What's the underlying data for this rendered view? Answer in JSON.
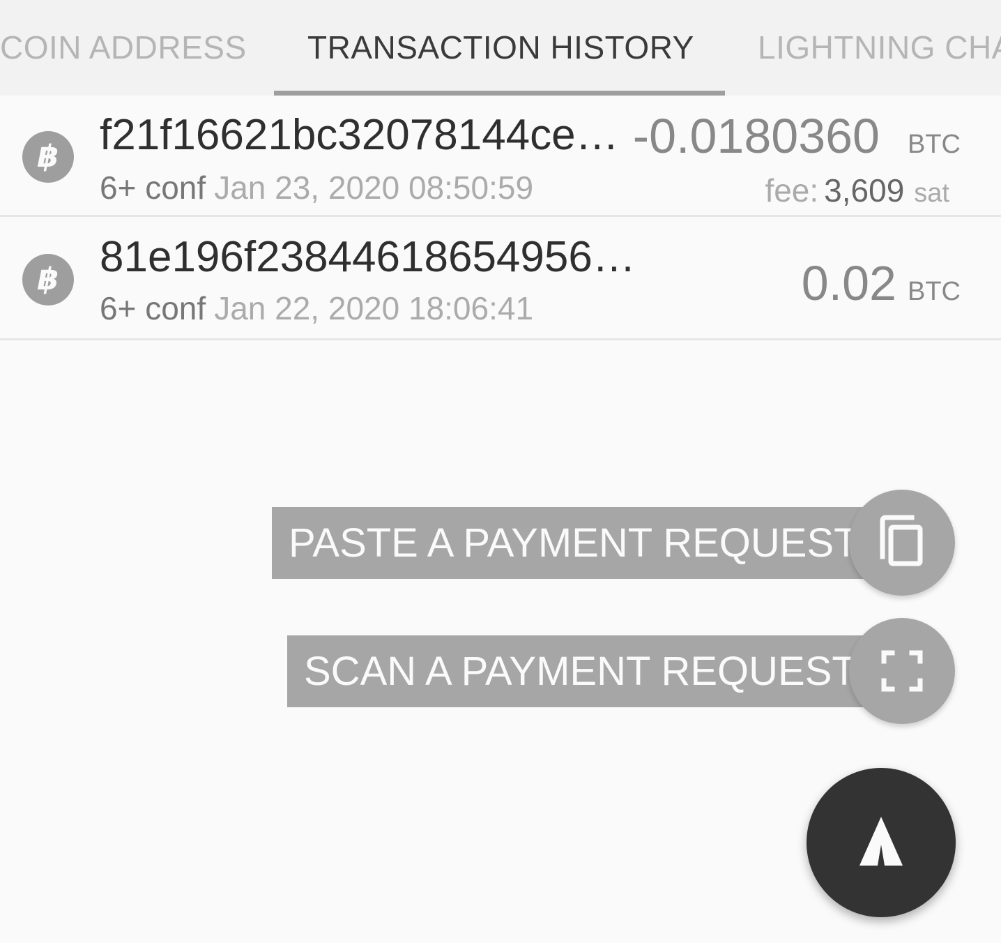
{
  "tabs": [
    {
      "label": "COIN ADDRESS",
      "active": false
    },
    {
      "label": "TRANSACTION HISTORY",
      "active": true
    },
    {
      "label": "LIGHTNING CHA",
      "active": false
    }
  ],
  "transactions": [
    {
      "icon": "bitcoin-icon",
      "hash": "f21f16621bc32078144ce…",
      "confirmations": "6+ conf",
      "date": "Jan 23, 2020 08:50:59",
      "amount": "-0.0180360",
      "unit": "BTC",
      "fee_label": "fee:",
      "fee_value": "3,609",
      "fee_unit": "sat"
    },
    {
      "icon": "bitcoin-icon",
      "hash": "81e196f23844618654956…",
      "confirmations": "6+ conf",
      "date": "Jan 22, 2020 18:06:41",
      "amount": "0.02",
      "unit": "BTC"
    }
  ],
  "speed_dial": {
    "paste": {
      "label": "PASTE A PAYMENT REQUEST",
      "icon": "copy-icon"
    },
    "scan": {
      "label": "SCAN A PAYMENT REQUEST",
      "icon": "scan-frame-icon"
    },
    "main": {
      "icon": "send-arrow-icon"
    }
  },
  "colors": {
    "tab_bar_bg": "#f2f2f2",
    "tab_active": "#3a3a3a",
    "tab_inactive": "#b5b5b5",
    "indicator": "#9e9e9e",
    "label_bg": "#a6a6a6",
    "main_fab": "#333333"
  }
}
